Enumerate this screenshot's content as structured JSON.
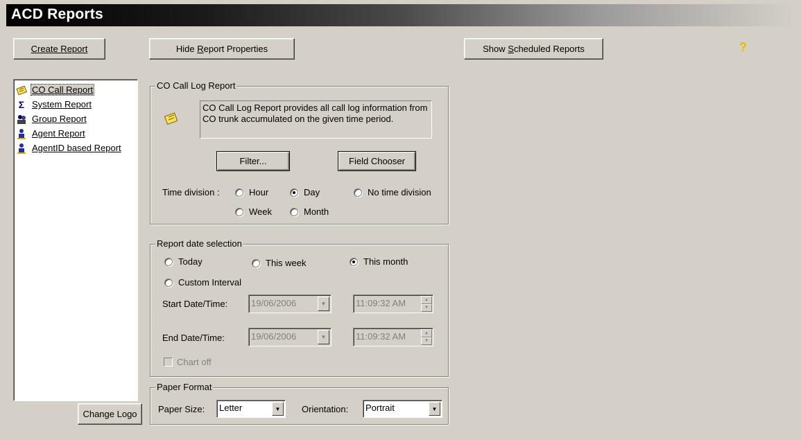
{
  "window": {
    "title": "ACD Reports"
  },
  "toolbar": {
    "create_report": "Create Report",
    "hide_properties_pre": "Hide ",
    "hide_properties_acc": "R",
    "hide_properties_post": "eport Properties",
    "show_scheduled_pre": "Show ",
    "show_scheduled_acc": "S",
    "show_scheduled_post": "cheduled Reports",
    "help_icon": "help-question-icon"
  },
  "report_list": {
    "items": [
      {
        "label": "CO Call Report",
        "icon": "note-icon",
        "selected": true
      },
      {
        "label": "System Report",
        "icon": "sigma-icon",
        "selected": false
      },
      {
        "label": "Group Report",
        "icon": "group-icon",
        "selected": false
      },
      {
        "label": "Agent Report",
        "icon": "agent-icon",
        "selected": false
      },
      {
        "label": "AgentID based Report",
        "icon": "agent-icon",
        "selected": false
      }
    ],
    "change_logo": "Change Logo"
  },
  "co_call_log": {
    "legend": "CO Call Log Report",
    "description": "CO Call Log Report provides all call log information from CO trunk accumulated on the given time period.",
    "filter_button": "Filter...",
    "field_chooser_button": "Field Chooser",
    "time_division_label": "Time division :",
    "options": {
      "hour": "Hour",
      "day": "Day",
      "no_division": "No time division",
      "week": "Week",
      "month": "Month"
    },
    "selected": "Day"
  },
  "date_selection": {
    "legend": "Report date selection",
    "options": {
      "today": "Today",
      "this_week": "This week",
      "this_month": "This month",
      "custom": "Custom Interval"
    },
    "selected": "This month",
    "start_label": "Start Date/Time:",
    "start_date": "19/06/2006",
    "start_time": "11:09:32 AM",
    "end_label": "End Date/Time:",
    "end_date": "19/06/2006",
    "end_time": "11:09:32 AM",
    "chart_off": "Chart off"
  },
  "paper_format": {
    "legend": "Paper Format",
    "paper_size_label": "Paper Size:",
    "paper_size": "Letter",
    "orientation_label": "Orientation:",
    "orientation": "Portrait"
  }
}
